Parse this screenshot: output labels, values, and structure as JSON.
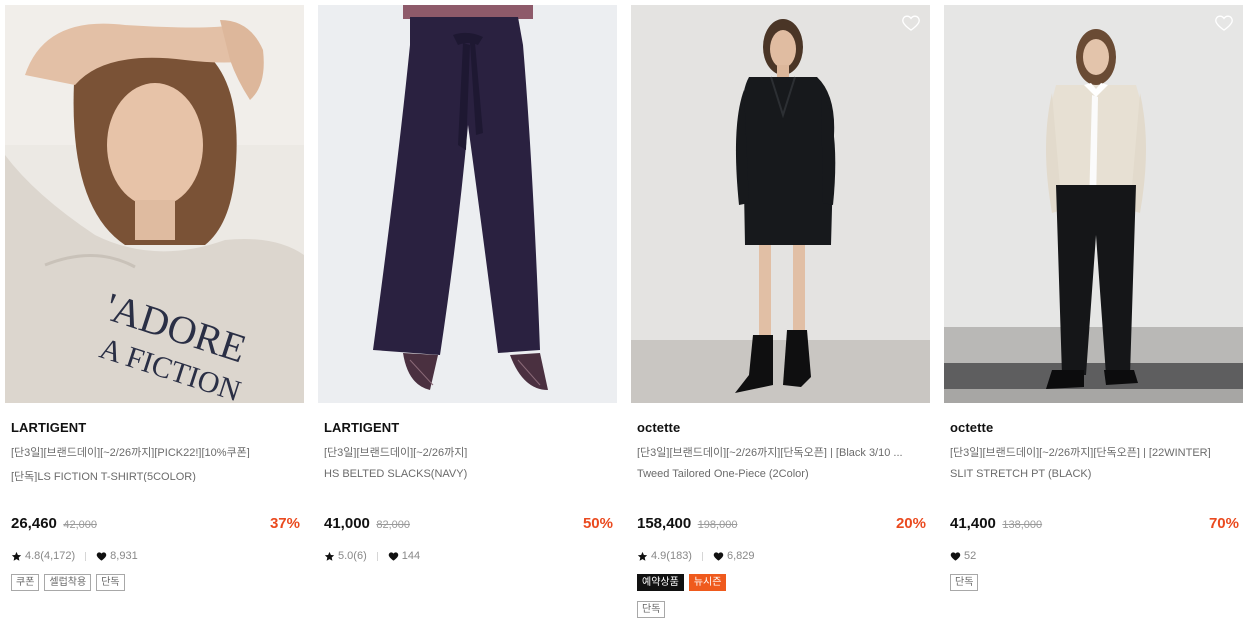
{
  "colors": {
    "discount": "#ea4a1f",
    "tag_black": "#111111",
    "tag_orange": "#ef5a1d"
  },
  "products": [
    {
      "brand": "LARTIGENT",
      "line1": "[단3일][브랜드데이][~2/26까지][PICK22!][10%쿠폰]",
      "line2": "[단독]LS FICTION T-SHIRT(5COLOR)",
      "price": "26,460",
      "original_price": "42,000",
      "discount": "37%",
      "rating": "4.8(4,172)",
      "likes": "8,931",
      "tags": [
        "쿠폰",
        "셀럽착용",
        "단독"
      ],
      "image_icon": "photo-model-sweatshirt"
    },
    {
      "brand": "LARTIGENT",
      "line1": "[단3일][브랜드데이][~2/26까지]",
      "line2": "HS BELTED SLACKS(NAVY)",
      "price": "41,000",
      "original_price": "82,000",
      "discount": "50%",
      "rating": "5.0(6)",
      "likes": "144",
      "tags": [],
      "image_icon": "photo-navy-slacks"
    },
    {
      "brand": "octette",
      "line1": "[단3일][브랜드데이][~2/26까지][단독오픈] | [Black 3/10 ...",
      "line2": "Tweed Tailored One-Piece (2Color)",
      "price": "158,400",
      "original_price": "198,000",
      "discount": "20%",
      "rating": "4.9(183)",
      "likes": "6,829",
      "badges": [
        "예약상품",
        "뉴시즌"
      ],
      "tags": [
        "단독"
      ],
      "image_icon": "photo-black-dress"
    },
    {
      "brand": "octette",
      "line1": "[단3일][브랜드데이][~2/26까지][단독오픈] | [22WINTER]",
      "line2": "SLIT STRETCH PT (BLACK)",
      "price": "41,400",
      "original_price": "138,000",
      "discount": "70%",
      "likes": "52",
      "tags": [
        "단독"
      ],
      "image_icon": "photo-black-pants"
    }
  ]
}
